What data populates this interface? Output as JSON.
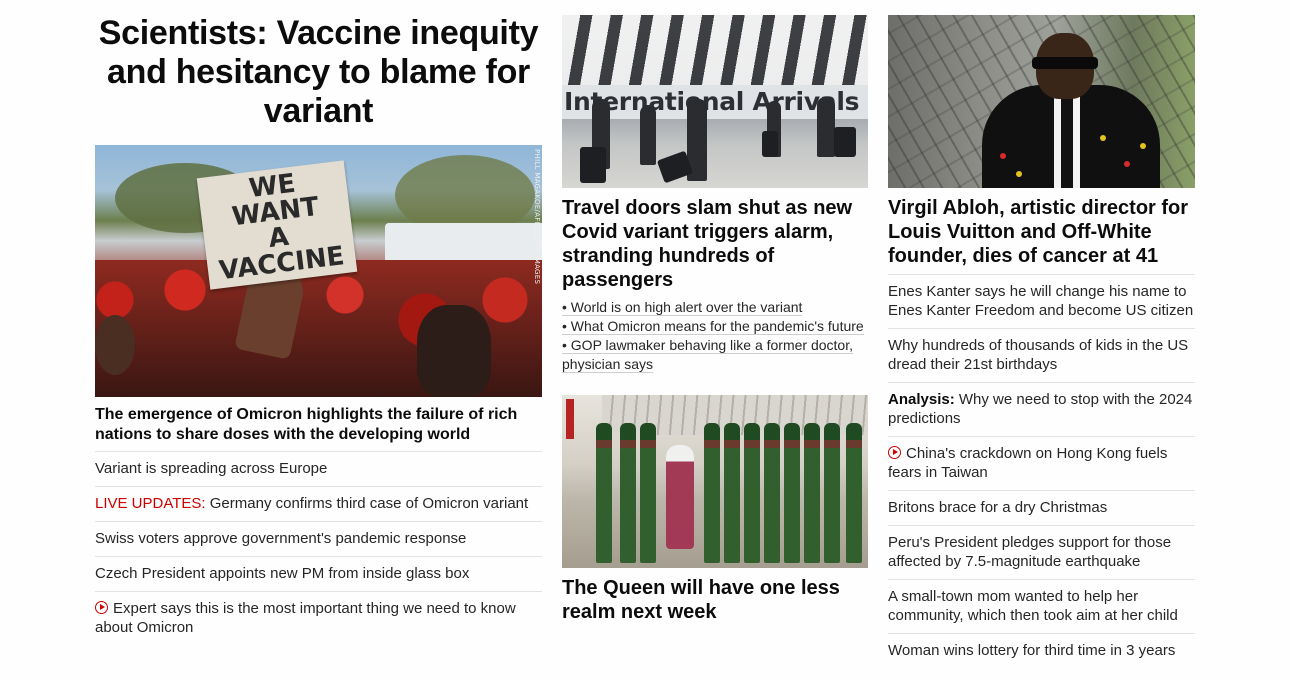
{
  "left": {
    "headline": "Scientists: Vaccine inequity and hesitancy to blame for variant",
    "image_sign_text": "WE\nWANT\nA\nVACCINE",
    "image_credit": "PHILL MAGAKOE/AFP/GETTY IMAGES",
    "caption": "The emergence of Omicron highlights the failure of rich nations to share doses with the developing world",
    "items": [
      {
        "text": "Variant is spreading across Europe"
      },
      {
        "prefix": "LIVE UPDATES:",
        "text": " Germany confirms third case of Omicron variant"
      },
      {
        "text": "Swiss voters approve government's pandemic response"
      },
      {
        "text": "Czech President appoints new PM from inside glass box"
      },
      {
        "icon": "play-icon",
        "text": "Expert says this is the most important thing we need to know about Omicron"
      }
    ]
  },
  "middle": {
    "image1_text": "International Arrivals",
    "headline1": "Travel doors slam shut as new Covid variant triggers alarm, stranding hundreds of passengers",
    "bullets": [
      "• World is on high alert over the variant",
      "• What Omicron means for the pandemic's future",
      "• GOP lawmaker behaving like a former doctor, physician says"
    ],
    "headline2": "The Queen will have one less realm next week"
  },
  "right": {
    "headline": "Virgil Abloh, artistic director for Louis Vuitton and Off-White founder, dies of cancer at 41",
    "items": [
      {
        "text": "Enes Kanter says he will change his name to Enes Kanter Freedom and become US citizen"
      },
      {
        "text": "Why hundreds of thousands of kids in the US dread their 21st birthdays"
      },
      {
        "bold_prefix": "Analysis:",
        "text": " Why we need to stop with the 2024 predictions"
      },
      {
        "icon": "play-icon",
        "text": "China's crackdown on Hong Kong fuels fears in Taiwan"
      },
      {
        "text": "Britons brace for a dry Christmas"
      },
      {
        "text": "Peru's President pledges support for those affected by 7.5-magnitude earthquake"
      },
      {
        "text": "A small-town mom wanted to help her community, which then took aim at her child"
      },
      {
        "text": "Woman wins lottery for third time in 3 years"
      }
    ]
  },
  "colors": {
    "live_red": "#cc0000",
    "text": "#0c0c0c",
    "divider": "#e2e2e2"
  }
}
